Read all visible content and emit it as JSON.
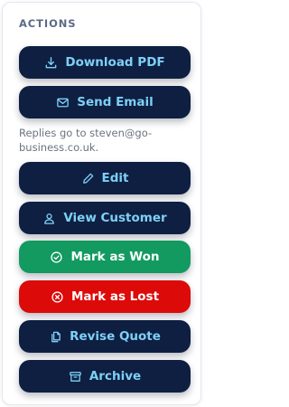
{
  "actions": {
    "heading": "ACTIONS",
    "download_pdf": {
      "label": "Download PDF",
      "icon": "download-icon"
    },
    "send_email": {
      "label": "Send Email",
      "icon": "mail-icon"
    },
    "replies_note": "Replies go to steven@go-business.co.uk.",
    "edit": {
      "label": "Edit",
      "icon": "pencil-icon"
    },
    "view_customer": {
      "label": "View Customer",
      "icon": "user-icon"
    },
    "mark_won": {
      "label": "Mark as Won",
      "icon": "check-circle-icon"
    },
    "mark_lost": {
      "label": "Mark as Lost",
      "icon": "x-circle-icon"
    },
    "revise_quote": {
      "label": "Revise Quote",
      "icon": "copy-icon"
    },
    "archive": {
      "label": "Archive",
      "icon": "archive-icon"
    }
  },
  "colors": {
    "navy": "#0e1f42",
    "navy_text": "#7ed0f6",
    "won_green": "#129a60",
    "lost_red": "#dd0a0a",
    "heading": "#5b6b86"
  }
}
